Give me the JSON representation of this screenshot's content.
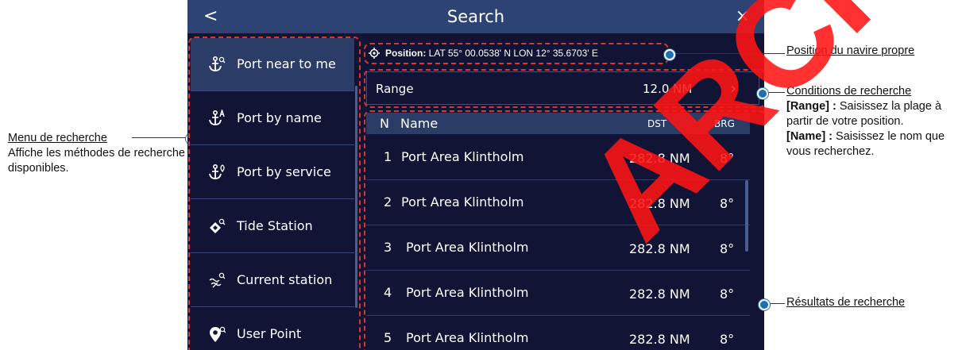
{
  "titlebar": {
    "title": "Search",
    "back": "<",
    "close": "×"
  },
  "menu": {
    "items": [
      {
        "label": "Port near to me",
        "icon": "anchor-search-icon",
        "active": true
      },
      {
        "label": "Port by name",
        "icon": "anchor-name-icon",
        "active": false
      },
      {
        "label": "Port by service",
        "icon": "anchor-service-icon",
        "active": false
      },
      {
        "label": "Tide Station",
        "icon": "tide-station-icon",
        "active": false
      },
      {
        "label": "Current station",
        "icon": "current-station-icon",
        "active": false
      },
      {
        "label": "User Point",
        "icon": "user-point-icon",
        "active": false
      }
    ]
  },
  "position": {
    "label": "Position:",
    "value": "LAT 55° 00.0538' N  LON 12° 35.6703' E"
  },
  "range": {
    "label": "Range",
    "value": "12.0 NM",
    "arrow": "›"
  },
  "results": {
    "headers": {
      "n": "N",
      "name": "Name",
      "dst": "DST",
      "brg": "BRG"
    },
    "rows": [
      {
        "n": "1",
        "name": "Port Area Klintholm",
        "dst": "282.8 NM",
        "brg": "8°"
      },
      {
        "n": "2",
        "name": "Port Area Klintholm",
        "dst": "282.8 NM",
        "brg": "8°"
      },
      {
        "n": "3",
        "name": "Port Area Klintholm",
        "dst": "282.8 NM",
        "brg": "8°"
      },
      {
        "n": "4",
        "name": "Port Area Klintholm",
        "dst": "282.8 NM",
        "brg": "8°"
      },
      {
        "n": "5",
        "name": "Port Area Klintholm",
        "dst": "282.8 NM",
        "brg": "8°"
      }
    ]
  },
  "annotations": {
    "menu_title": "Menu de recherche",
    "menu_desc": "Affiche les méthodes de recherche disponibles.",
    "position_title": "Position du navire propre",
    "conditions_title": "Conditions de recherche",
    "range_key": "[Range] :",
    "range_desc": "Saisissez la plage à partir de votre position.",
    "name_key": "[Name] :",
    "name_desc": "Saisissez le nom que vous recherchez.",
    "results_title": "Résultats de recherche"
  },
  "watermark": "ARCHIVE",
  "colors": {
    "titlebar": "#2d4373",
    "background": "#121436",
    "selected": "#2b3c66",
    "callout_border": "#d9352b",
    "callout_dot": "#1f6fb3"
  }
}
